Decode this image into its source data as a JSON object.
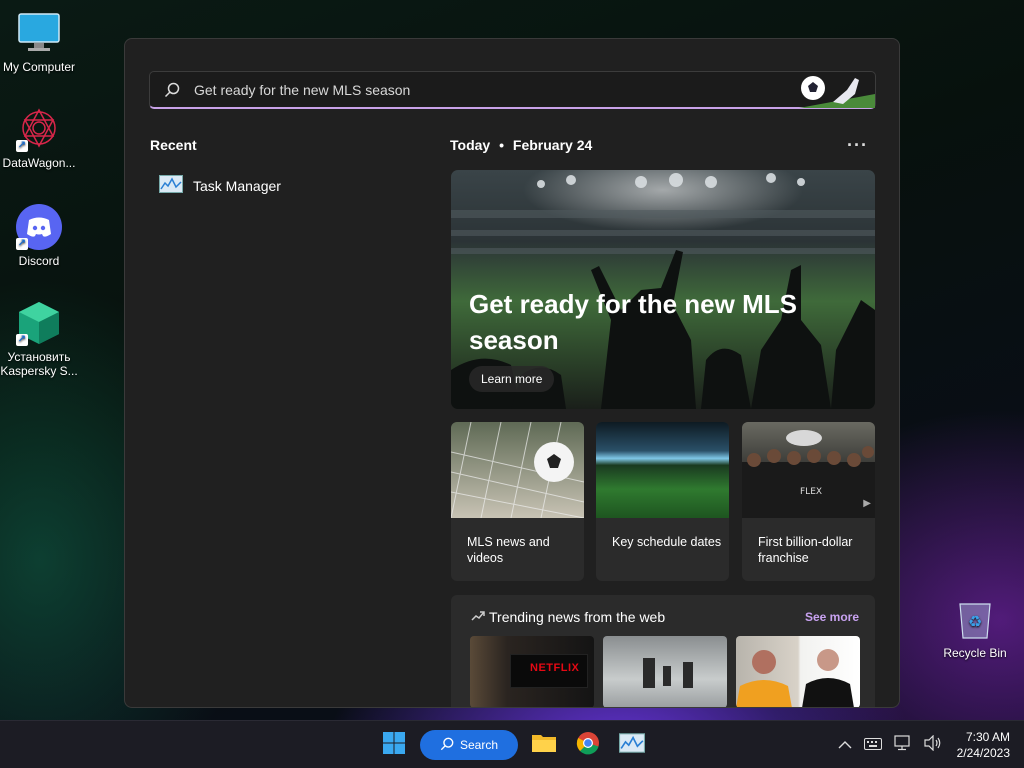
{
  "desktop": {
    "icons": [
      {
        "label": "My Computer",
        "icon": "monitor-icon"
      },
      {
        "label": "DataWagon...",
        "icon": "datawagon-icon"
      },
      {
        "label": "Discord",
        "icon": "discord-icon"
      },
      {
        "label": "Установить Kaspersky S...",
        "icon": "kaspersky-icon"
      },
      {
        "label": "Recycle Bin",
        "icon": "recycle-bin-icon"
      }
    ]
  },
  "search": {
    "value": "Get ready for the new MLS season",
    "placeholder": ""
  },
  "recent": {
    "title": "Recent",
    "items": [
      {
        "label": "Task Manager",
        "icon": "task-manager-icon"
      }
    ]
  },
  "today": {
    "label": "Today",
    "date": "February 24",
    "more": "···"
  },
  "hero": {
    "title": "Get ready for the new MLS season",
    "button": "Learn more"
  },
  "cards": [
    {
      "label": "MLS news and videos"
    },
    {
      "label": "Key schedule dates"
    },
    {
      "label": "First billion-dollar franchise"
    }
  ],
  "trending": {
    "title": "Trending news from the web",
    "see_more": "See more",
    "netflix": "NETFLIX"
  },
  "taskbar": {
    "search_label": "Search",
    "time": "7:30 AM",
    "date": "2/24/2023"
  },
  "colors": {
    "accent": "#1f6fe0",
    "search_underline": "#c8a2e8",
    "link": "#c8a2f0"
  }
}
